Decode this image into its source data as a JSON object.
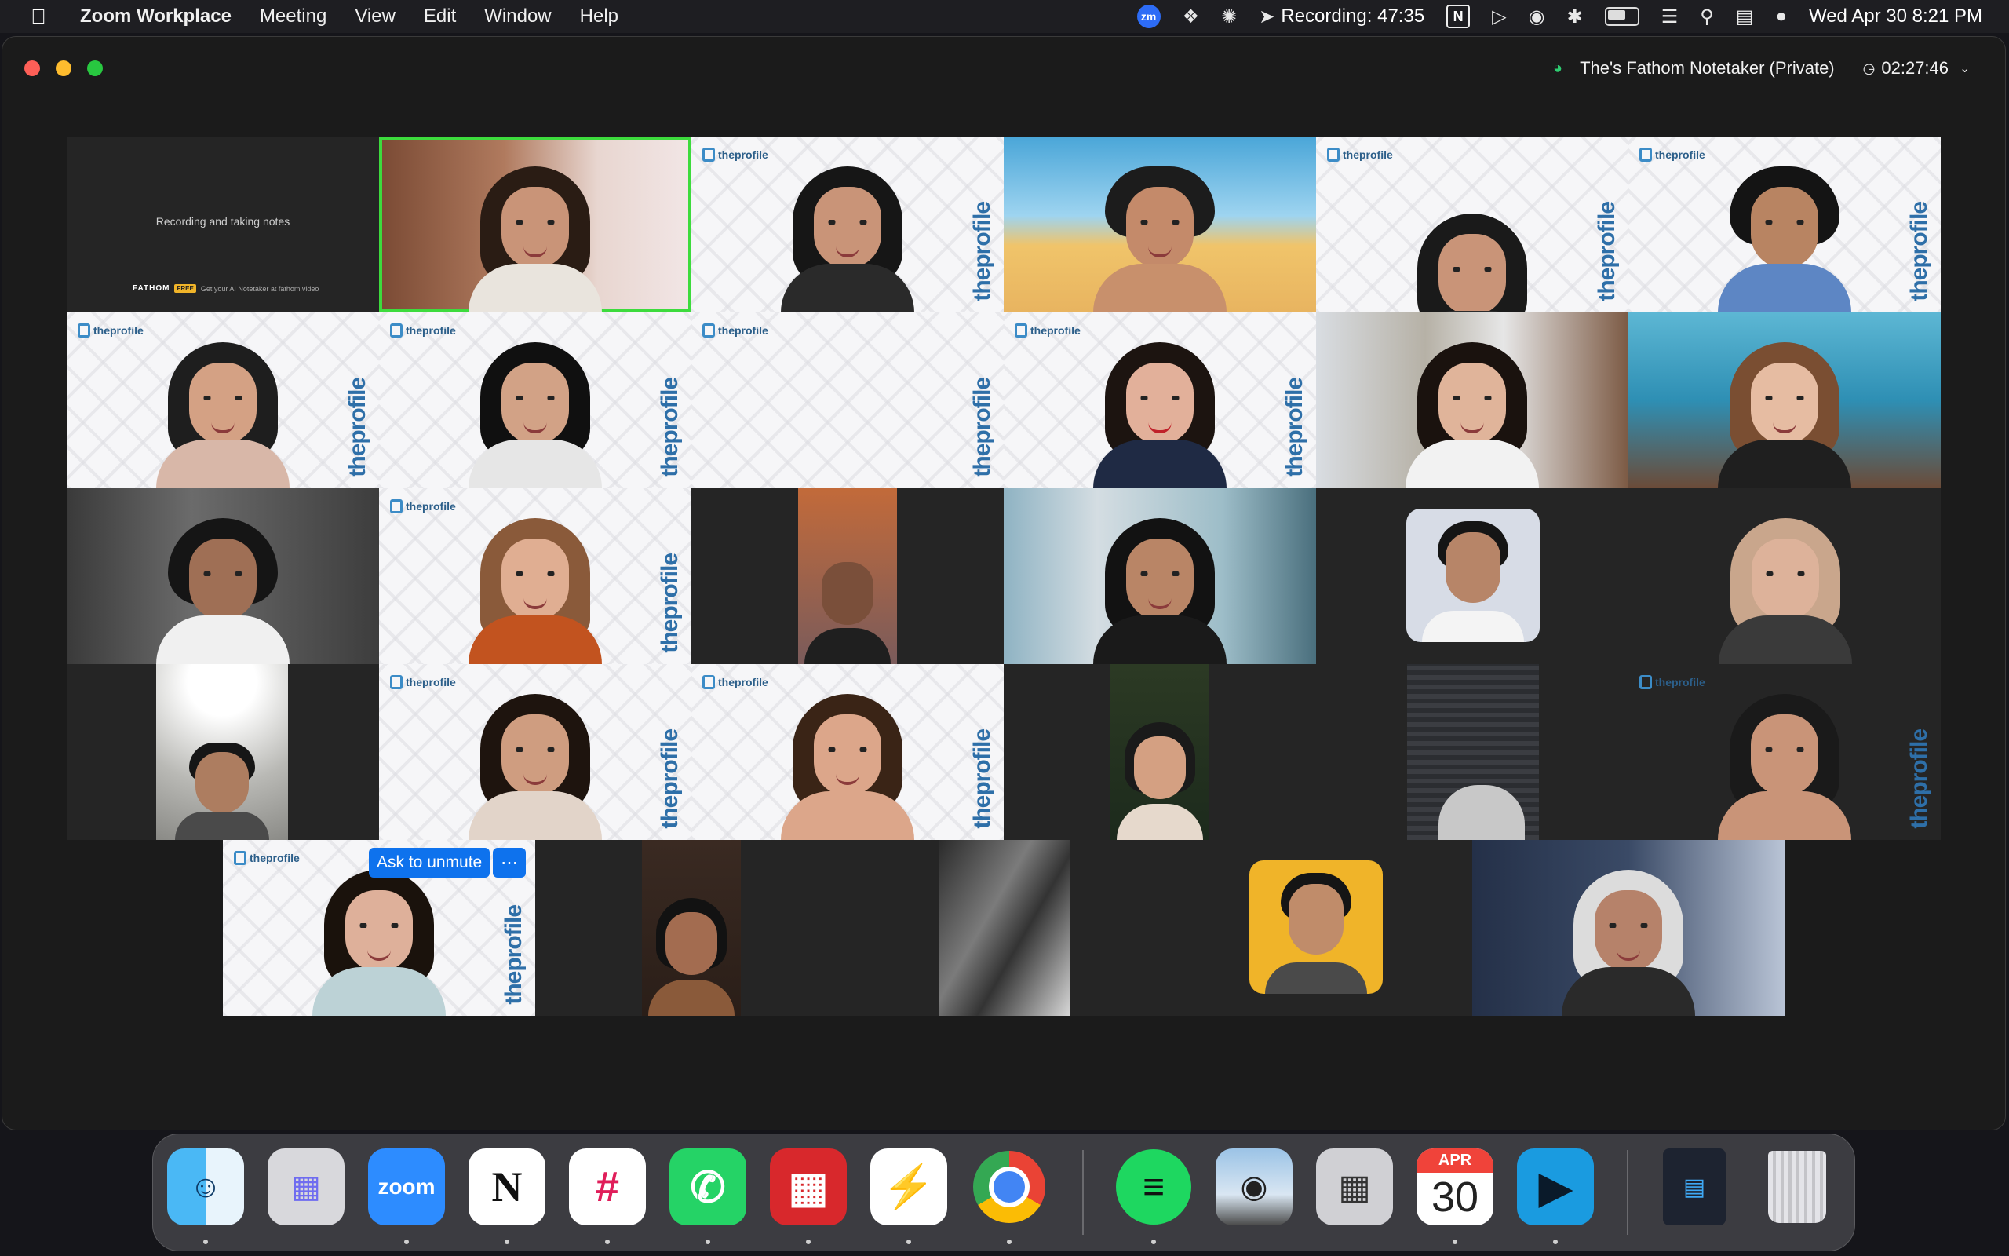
{
  "menubar": {
    "app_name": "Zoom Workplace",
    "menus": [
      "Meeting",
      "View",
      "Edit",
      "Window",
      "Help"
    ],
    "zm_badge": "zm",
    "recording": "Recording: 47:35",
    "notion_glyph": "N",
    "datetime": "Wed Apr 30  8:21 PM"
  },
  "window": {
    "notetaker_label": "The's Fathom Notetaker (Private)",
    "meeting_timer": "02:27:46"
  },
  "fathom_tile": {
    "status": "Recording and taking notes",
    "brand": "FATHOM",
    "free_badge": "FREE",
    "promo": "Get your AI Notetaker at fathom.video"
  },
  "branding": {
    "small": "theprofile",
    "vertical": "theprofile"
  },
  "participant_tile": {
    "unmute_label": "Ask to unmute",
    "more_label": "⋯"
  },
  "dock": {
    "zoom_label": "zoom",
    "notion_label": "N",
    "calendar_month": "APR",
    "calendar_day": "30"
  },
  "colors": {
    "zoom_blue": "#0e72ed",
    "active_speaker": "#3ddb3d",
    "brand_blue": "#2e6fa8"
  }
}
